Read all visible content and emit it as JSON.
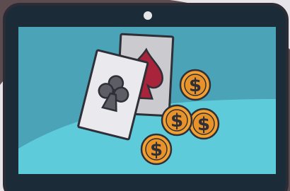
{
  "colors": {
    "page_background": "#5C4C4F",
    "backdrop_blob": "#E6E4E8",
    "device_frame": "#1B2C38",
    "frame_outline": "#2C2C34",
    "camera": "#E6E6E8",
    "screen_top": "#4BA3B8",
    "screen_bottom": "#5ECBDA",
    "card_face": "#EAEAEE",
    "card_back": "#CBCBCF",
    "card_outline": "#2F2F37",
    "club_suit": "#5D5D66",
    "spade_suit": "#A8243A",
    "coin_fill": "#F4A030",
    "coin_inner": "#E8922A",
    "coin_outline": "#2F2F37",
    "dollar_sign": "#2F2F37"
  },
  "icons": {
    "club": "club-suit-icon",
    "spade": "spade-suit-icon",
    "coin": "dollar-coin-icon"
  },
  "coins": {
    "symbol": "$"
  }
}
